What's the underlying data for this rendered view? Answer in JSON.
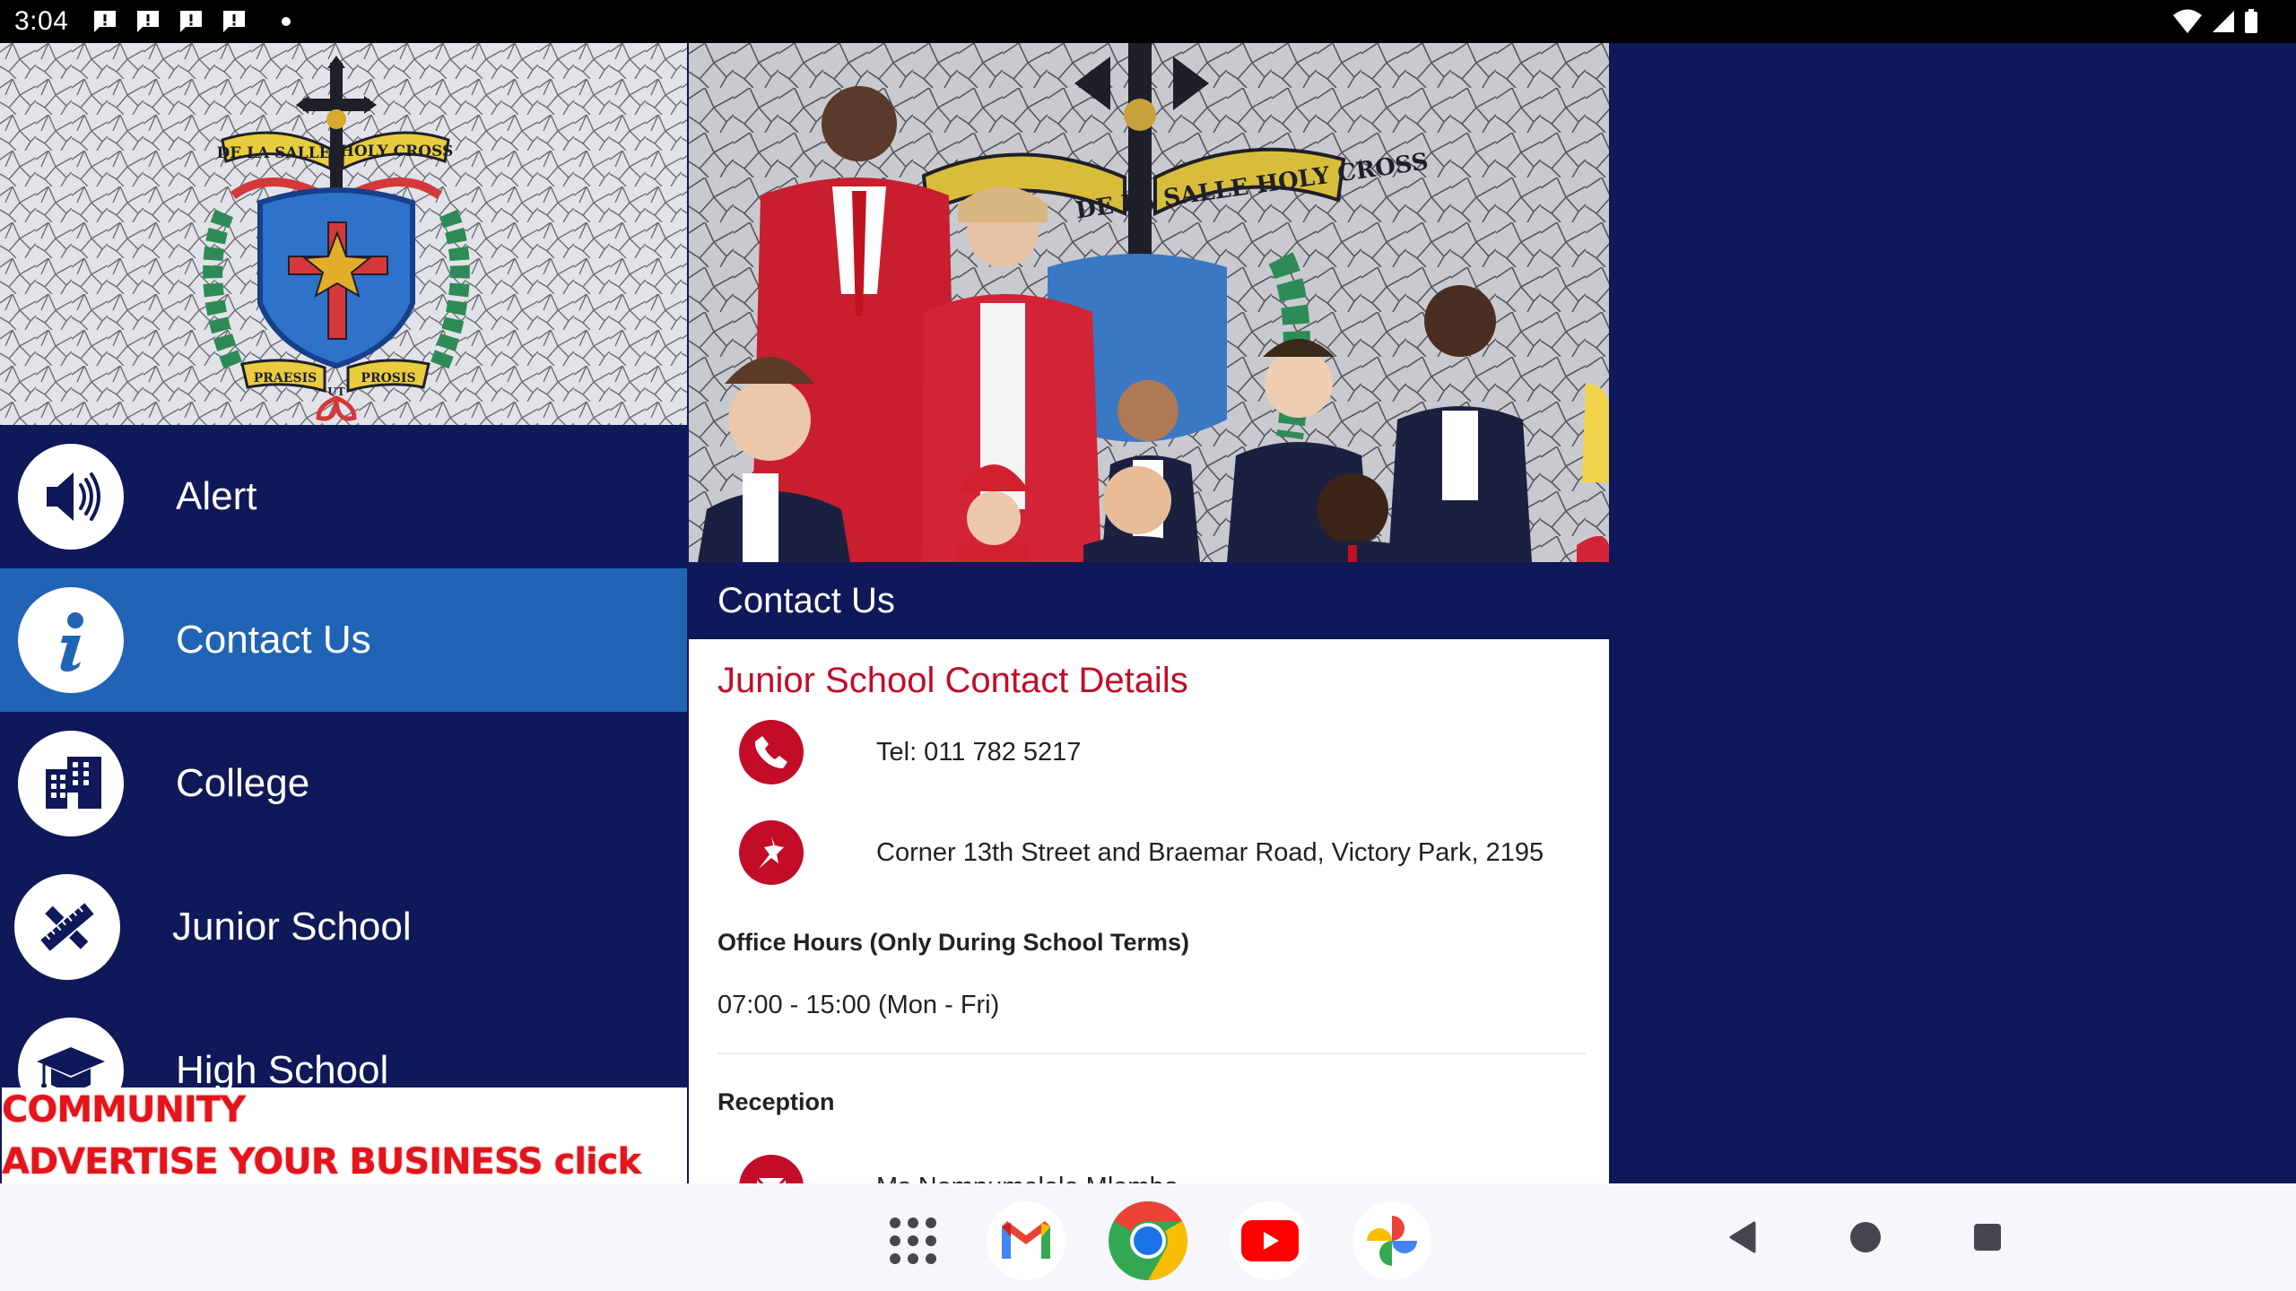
{
  "status_bar": {
    "time": "3:04",
    "notification_count": 4,
    "icons": [
      "notification-alert-icon",
      "notification-alert-icon",
      "notification-alert-icon",
      "notification-alert-icon",
      "more-dot-icon"
    ],
    "right_icons": [
      "wifi-icon",
      "cell-signal-icon",
      "battery-icon"
    ]
  },
  "sidebar": {
    "header_image": {
      "description": "Mosaic school crest",
      "banner_top": [
        "DE LA SALLE",
        "HOLY CROSS"
      ],
      "motto": [
        "PRAESIS",
        "UT",
        "PROSIS"
      ]
    },
    "items": [
      {
        "label": "Alert",
        "icon": "speaker-icon",
        "selected": false
      },
      {
        "label": "Contact Us",
        "icon": "info-icon",
        "selected": true
      },
      {
        "label": "College",
        "icon": "building-icon",
        "selected": false
      },
      {
        "label": "Junior School",
        "icon": "ruler-pencil-icon",
        "selected": false
      },
      {
        "label": "High School",
        "icon": "graduation-cap-icon",
        "selected": false
      }
    ],
    "ad_banner": {
      "line1": "SUPPORT OUR DLSHCC COMMUNITY",
      "line2": "ADVERTISE YOUR BUSINESS click here"
    }
  },
  "content": {
    "photo": {
      "description": "Group photo of students in school blazers in front of mosaic crest",
      "crest_text": "DE LA SALLE HOLY CROSS"
    },
    "header_title": "Contact Us",
    "section_title": "Junior School Contact Details",
    "contacts": [
      {
        "icon": "phone-icon",
        "text": "Tel: 011 782 5217"
      },
      {
        "icon": "pushpin-icon",
        "text": "Corner 13th Street and Braemar Road, Victory Park, 2195"
      }
    ],
    "office_hours_heading": "Office Hours (Only During School Terms)",
    "office_hours": "07:00 - 15:00 (Mon - Fri)",
    "reception_heading": "Reception",
    "reception_contact": {
      "icon": "mail-icon",
      "text": "Ms Nompumelelo Mlambo"
    }
  },
  "nav_bar": {
    "dock": [
      {
        "name": "app-drawer",
        "icon": "app-grid-icon"
      },
      {
        "name": "gmail",
        "icon": "gmail-icon"
      },
      {
        "name": "chrome",
        "icon": "chrome-icon"
      },
      {
        "name": "youtube",
        "icon": "youtube-icon"
      },
      {
        "name": "photos",
        "icon": "photos-icon"
      }
    ],
    "system": [
      {
        "name": "back",
        "icon": "back-icon"
      },
      {
        "name": "home",
        "icon": "home-icon"
      },
      {
        "name": "recents",
        "icon": "recents-icon"
      }
    ]
  },
  "colors": {
    "navy": "#0f1858",
    "selected_blue": "#2164b6",
    "accent_red": "#c20c28",
    "ad_red": "#e3141b"
  }
}
